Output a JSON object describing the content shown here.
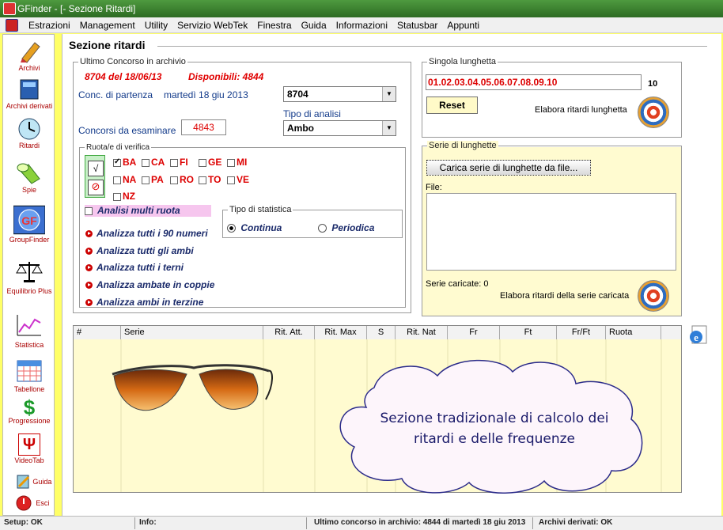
{
  "window": {
    "title": "GFinder - [- Sezione Ritardi]"
  },
  "menu": [
    "Estrazioni",
    "Management",
    "Utility",
    "Servizio WebTek",
    "Finestra",
    "Guida",
    "Informazioni",
    "Statusbar",
    "Appunti"
  ],
  "sidebar": [
    {
      "label": "Archivi",
      "icon": "pencil-icon"
    },
    {
      "label": "Archivi derivati",
      "icon": "book-icon"
    },
    {
      "label": "Ritardi",
      "icon": "clock-icon"
    },
    {
      "label": "Spie",
      "icon": "flashlight-icon"
    },
    {
      "label": "GroupFinder",
      "icon": "globe-gf-icon"
    },
    {
      "label": "Equilibrio Plus",
      "icon": "scales-icon"
    },
    {
      "label": "Statistica",
      "icon": "chart-icon"
    },
    {
      "label": "Tabellone",
      "icon": "calendar-icon"
    },
    {
      "label": "Progressione",
      "icon": "dollar-icon"
    },
    {
      "label": "VideoTab",
      "icon": "psi-icon"
    },
    {
      "label": "Guida",
      "icon": "guide-icon"
    },
    {
      "label": "Esci",
      "icon": "exit-icon"
    }
  ],
  "section": {
    "title": "Sezione ritardi"
  },
  "ultimo": {
    "legend": "Ultimo Concorso in archivio",
    "concorso": "8704 del 18/06/13",
    "disponibili": "Disponibili: 4844",
    "conc_label": "Conc. di partenza",
    "conc_date": "martedì 18 giu 2013",
    "conc_value": "8704",
    "tipo_label": "Tipo di analisi",
    "tipo_value": "Ambo",
    "concorsi_label": "Concorsi da esaminare",
    "concorsi_value": "4843"
  },
  "ruote": {
    "legend": "Ruota/e di verifica",
    "items": [
      {
        "name": "BA",
        "checked": true
      },
      {
        "name": "CA",
        "checked": false
      },
      {
        "name": "FI",
        "checked": false
      },
      {
        "name": "GE",
        "checked": false
      },
      {
        "name": "MI",
        "checked": false
      },
      {
        "name": "NA",
        "checked": false
      },
      {
        "name": "PA",
        "checked": false
      },
      {
        "name": "RO",
        "checked": false
      },
      {
        "name": "TO",
        "checked": false
      },
      {
        "name": "VE",
        "checked": false
      },
      {
        "name": "NZ",
        "checked": false
      }
    ],
    "multi": "Analisi multi ruota"
  },
  "stat": {
    "legend": "Tipo di statistica",
    "continua": "Continua",
    "periodica": "Periodica"
  },
  "actions": [
    "Analizza tutti i 90 numeri",
    "Analizza tutti gli ambi",
    "Analizza tutti i terni",
    "Analizza ambate in coppie",
    "Analizza ambi in terzine"
  ],
  "lunghetta": {
    "legend": "Singola lunghetta",
    "value": "01.02.03.04.05.06.07.08.09.10",
    "count": "10",
    "reset": "Reset",
    "elabora": "Elabora ritardi lunghetta"
  },
  "serie": {
    "legend": "Serie di lunghette",
    "carica": "Carica serie di lunghette da file...",
    "file_label": "File:",
    "caricate": "Serie caricate: 0",
    "elabora": "Elabora ritardi della serie caricata"
  },
  "grid": {
    "columns": [
      "#",
      "Serie",
      "Rit. Att.",
      "Rit. Max",
      "S",
      "Rit. Nat",
      "Fr",
      "Ft",
      "Fr/Ft",
      "Ruota"
    ]
  },
  "cloud": {
    "text": "Sezione tradizionale di calcolo dei ritardi e delle frequenze"
  },
  "statusbar": {
    "setup": "Setup: OK",
    "info": "Info:",
    "ultimo": "Ultimo concorso in archivio: 4844 di martedì 18 giu 2013",
    "derivati": "Archivi derivati: OK"
  }
}
